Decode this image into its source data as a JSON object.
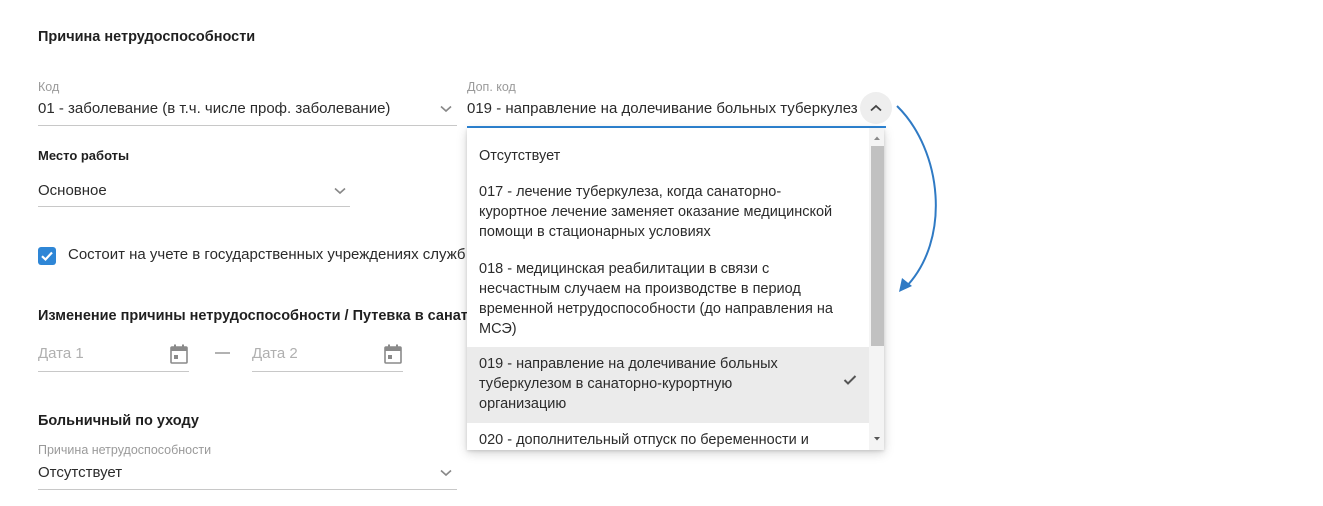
{
  "sections": {
    "reason_title": "Причина нетрудоспособности",
    "change_title": "Изменение причины нетрудоспособности / Путевка в санато",
    "care_title": "Больничный по уходу"
  },
  "code_field": {
    "label": "Код",
    "value": "01 - заболевание (в т.ч. числе проф. заболевание)"
  },
  "extra_code_field": {
    "label": "Доп. код",
    "value": "019 - направление на долечивание больных туберкулез"
  },
  "workplace": {
    "label": "Место работы",
    "value": "Основное"
  },
  "registered_checkbox": {
    "checked": true,
    "label": "Состоит на учете в государственных учреждениях служб"
  },
  "dates": {
    "date1_placeholder": "Дата 1",
    "separator": "—",
    "date2_placeholder": "Дата 2"
  },
  "care_reason": {
    "label": "Причина нетрудоспособности",
    "value": "Отсутствует"
  },
  "dropdown": {
    "items": [
      {
        "text": "Отсутствует",
        "selected": false
      },
      {
        "text": "017 - лечение туберкулеза, когда санаторно-курортное лечение заменяет оказание медицинской помощи в стационарных условиях",
        "selected": false
      },
      {
        "text": "018 - медицинская реабилитации в связи с несчастным случаем на производстве в период временной нетрудоспособности (до направления на МСЭ)",
        "selected": false
      },
      {
        "text": "019 - направление на долечивание больных туберкулезом в санаторно-курортную организацию",
        "selected": true
      },
      {
        "text": "020 - дополнительный отпуск по беременности и",
        "selected": false
      }
    ]
  },
  "colors": {
    "accent": "#2e86d6",
    "arrow": "#2f7ac4",
    "selected_bg": "#ebebeb"
  },
  "icons": {
    "chevron_down": "chevron-down-icon",
    "chevron_up": "chevron-up-icon",
    "calendar": "calendar-icon",
    "check": "check-icon"
  }
}
